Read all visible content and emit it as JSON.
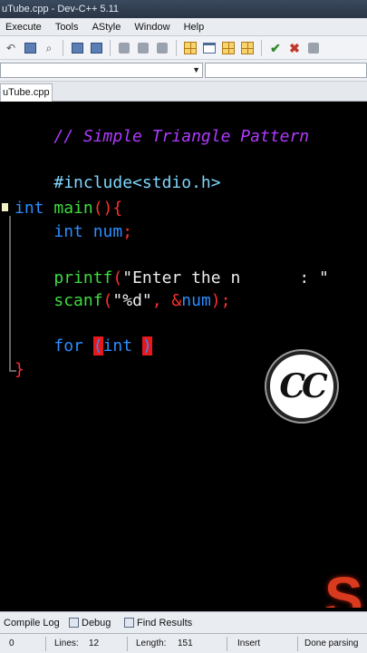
{
  "window": {
    "title": "uTube.cpp - Dev-C++ 5.11"
  },
  "menu": {
    "items": [
      "Execute",
      "Tools",
      "AStyle",
      "Window",
      "Help"
    ]
  },
  "toolbar": {
    "icons": [
      "undo-icon",
      "paste-icon",
      "find-icon",
      "grid-icon",
      "run-icon",
      "stop-icon",
      "layout-icon",
      "window-icon",
      "grid-icon",
      "check-icon",
      "x-icon",
      "gray-icon",
      "gray-icon"
    ]
  },
  "editor_tab": {
    "label": "uTube.cpp"
  },
  "code": {
    "comment": "// Simple Triangle Pattern",
    "include": "#include<stdio.h>",
    "main_kw": "int",
    "main_fn": "main",
    "main_punc": "(){",
    "decl_kw": "int",
    "decl_id": "num",
    "decl_punc": ";",
    "printf_fn": "printf",
    "printf_open": "(",
    "printf_str": "\"Enter the n",
    "printf_tail": ": \"",
    "scanf_fn": "scanf",
    "scanf_open": "(",
    "scanf_str": "\"%d\"",
    "scanf_comma": ",",
    "scanf_amp": " &",
    "scanf_id": "num",
    "scanf_close": ");",
    "for_kw": "for",
    "for_open": "(",
    "for_int": "int",
    "for_cursor": ")",
    "close_brace": "}"
  },
  "overlay": {
    "cc_badge": "CC",
    "red_letter": "S"
  },
  "bottom_tabs": [
    "Compile Log",
    "Debug",
    "Find Results"
  ],
  "status": {
    "col": "0",
    "lines_label": "Lines:",
    "lines_value": "12",
    "length_label": "Length:",
    "length_value": "151",
    "mode": "Insert",
    "parse": "Done parsing"
  }
}
